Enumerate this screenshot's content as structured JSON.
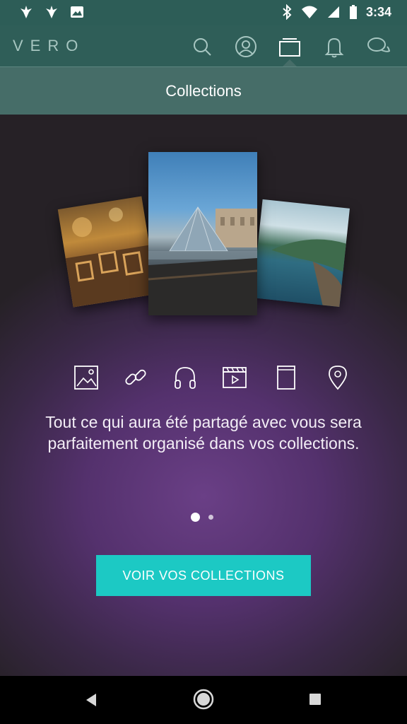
{
  "status_bar": {
    "time": "3:34",
    "left_icons": [
      "notification-app-icon",
      "notification-app-icon",
      "image-notification-icon"
    ],
    "right_icons": [
      "bluetooth-icon",
      "wifi-icon",
      "signal-icon",
      "battery-icon"
    ]
  },
  "app": {
    "logo": "VERO",
    "nav": [
      "search-icon",
      "profile-icon",
      "collections-icon",
      "notifications-icon",
      "chat-icon"
    ],
    "active_nav": "collections-icon"
  },
  "page": {
    "title": "Collections"
  },
  "onboarding": {
    "feature_icons": [
      "photo-icon",
      "link-icon",
      "music-icon",
      "movie-icon",
      "book-icon",
      "place-icon"
    ],
    "description": "Tout ce qui aura été partagé avec vous sera parfaitement organisé dans vos collections.",
    "pages_total": 2,
    "current_page": 1,
    "cta_label": "VOIR VOS COLLECTIONS"
  },
  "colors": {
    "status_bar": "#2d5d57",
    "app_bar": "#2f5e58",
    "title_bar": "#466d68",
    "accent": "#1cc9c4",
    "background": "#54316d"
  },
  "system_nav": [
    "back-icon",
    "home-icon",
    "recents-icon"
  ]
}
